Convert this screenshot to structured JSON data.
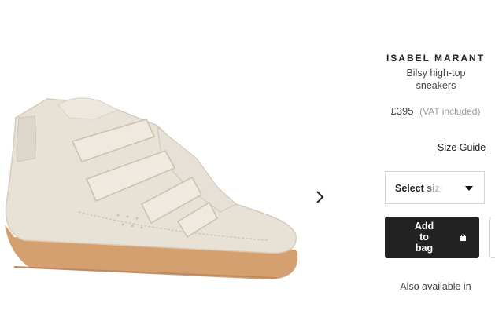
{
  "product": {
    "brand": "ISABEL MARANT",
    "name": "Bilsy high-top sneakers",
    "price": "£395",
    "vat_note": "(VAT included)"
  },
  "links": {
    "size_guide": "Size Guide",
    "also_available": "Also available in"
  },
  "size_select": {
    "label": "Select size"
  },
  "actions": {
    "add_to_bag_lines": [
      "Add",
      "to",
      "bag"
    ]
  },
  "icons": {
    "next": "chevron-right-icon",
    "dropdown": "caret-down-icon",
    "bag": "shopping-bag-icon"
  },
  "colors": {
    "button_bg": "#222222",
    "suede": "#e8e1d6",
    "sole": "#d4a070"
  }
}
